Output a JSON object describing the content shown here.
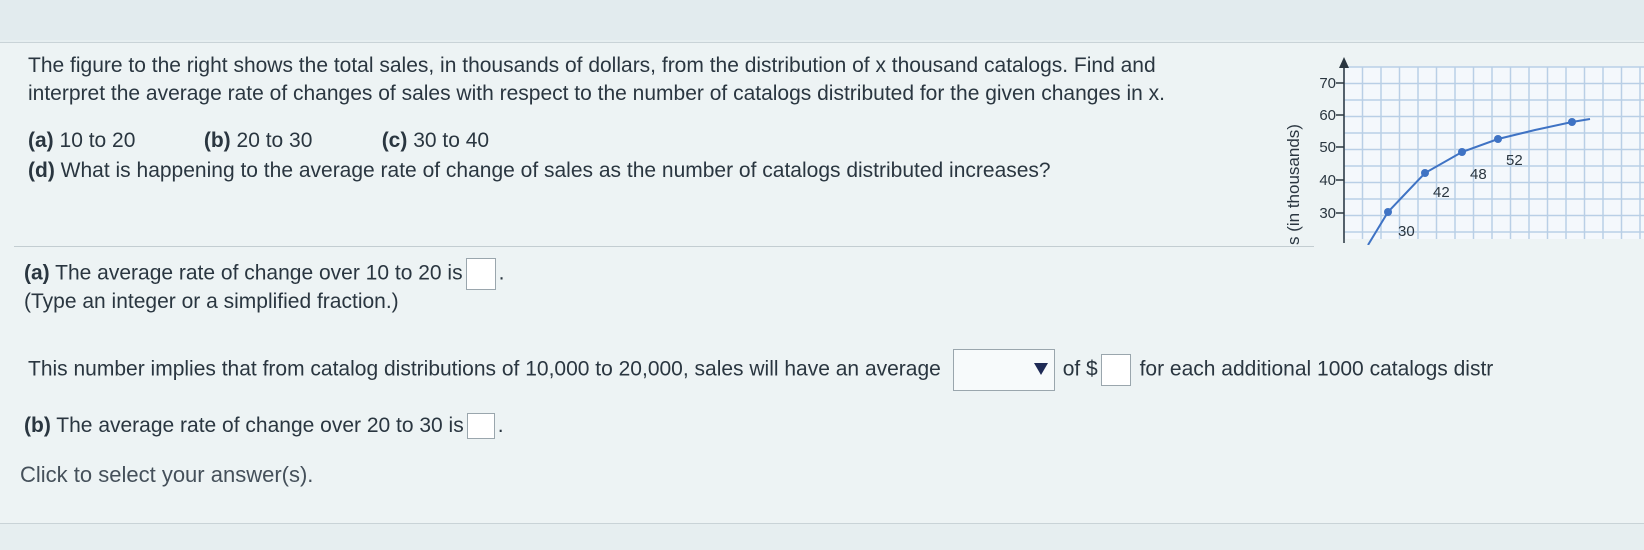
{
  "question": {
    "line1": "The figure to the right shows the total sales, in thousands of dollars, from the distribution of x thousand catalogs. Find and",
    "line2": "interpret the average rate of changes of sales with respect to the number of catalogs distributed for the given changes in x.",
    "parts": [
      {
        "tag": "(a)",
        "text": "10 to 20"
      },
      {
        "tag": "(b)",
        "text": "20 to 30"
      },
      {
        "tag": "(c)",
        "text": "30 to 40"
      }
    ],
    "part_d_tag": "(d)",
    "part_d_text": "What is happening to the average rate of change of sales as the number of catalogs distributed increases?"
  },
  "graph": {
    "y_axis_label": "s (in thousands)",
    "y_ticks": [
      "30",
      "40",
      "50",
      "60",
      "70"
    ],
    "point_labels": [
      "30",
      "42",
      "48",
      "52"
    ],
    "curve_color": "#3f73c4",
    "grid_color": "#b9cfe6"
  },
  "answer_a": {
    "tag": "(a)",
    "prefix": "The average rate of change over 10 to 20 is",
    "suffix": ".",
    "hint": "(Type an integer or a simplified fraction.)"
  },
  "implication": {
    "prefix": "This number implies that from catalog distributions of 10,000 to 20,000, sales will have an average",
    "dropdown_value": "",
    "middle": "of $",
    "suffix": "for each additional 1000 catalogs distr"
  },
  "answer_b": {
    "tag": "(b)",
    "prefix": "The average rate of change over 20 to 30 is",
    "suffix": "."
  },
  "footer": {
    "hint": "Click to select your answer(s)."
  }
}
